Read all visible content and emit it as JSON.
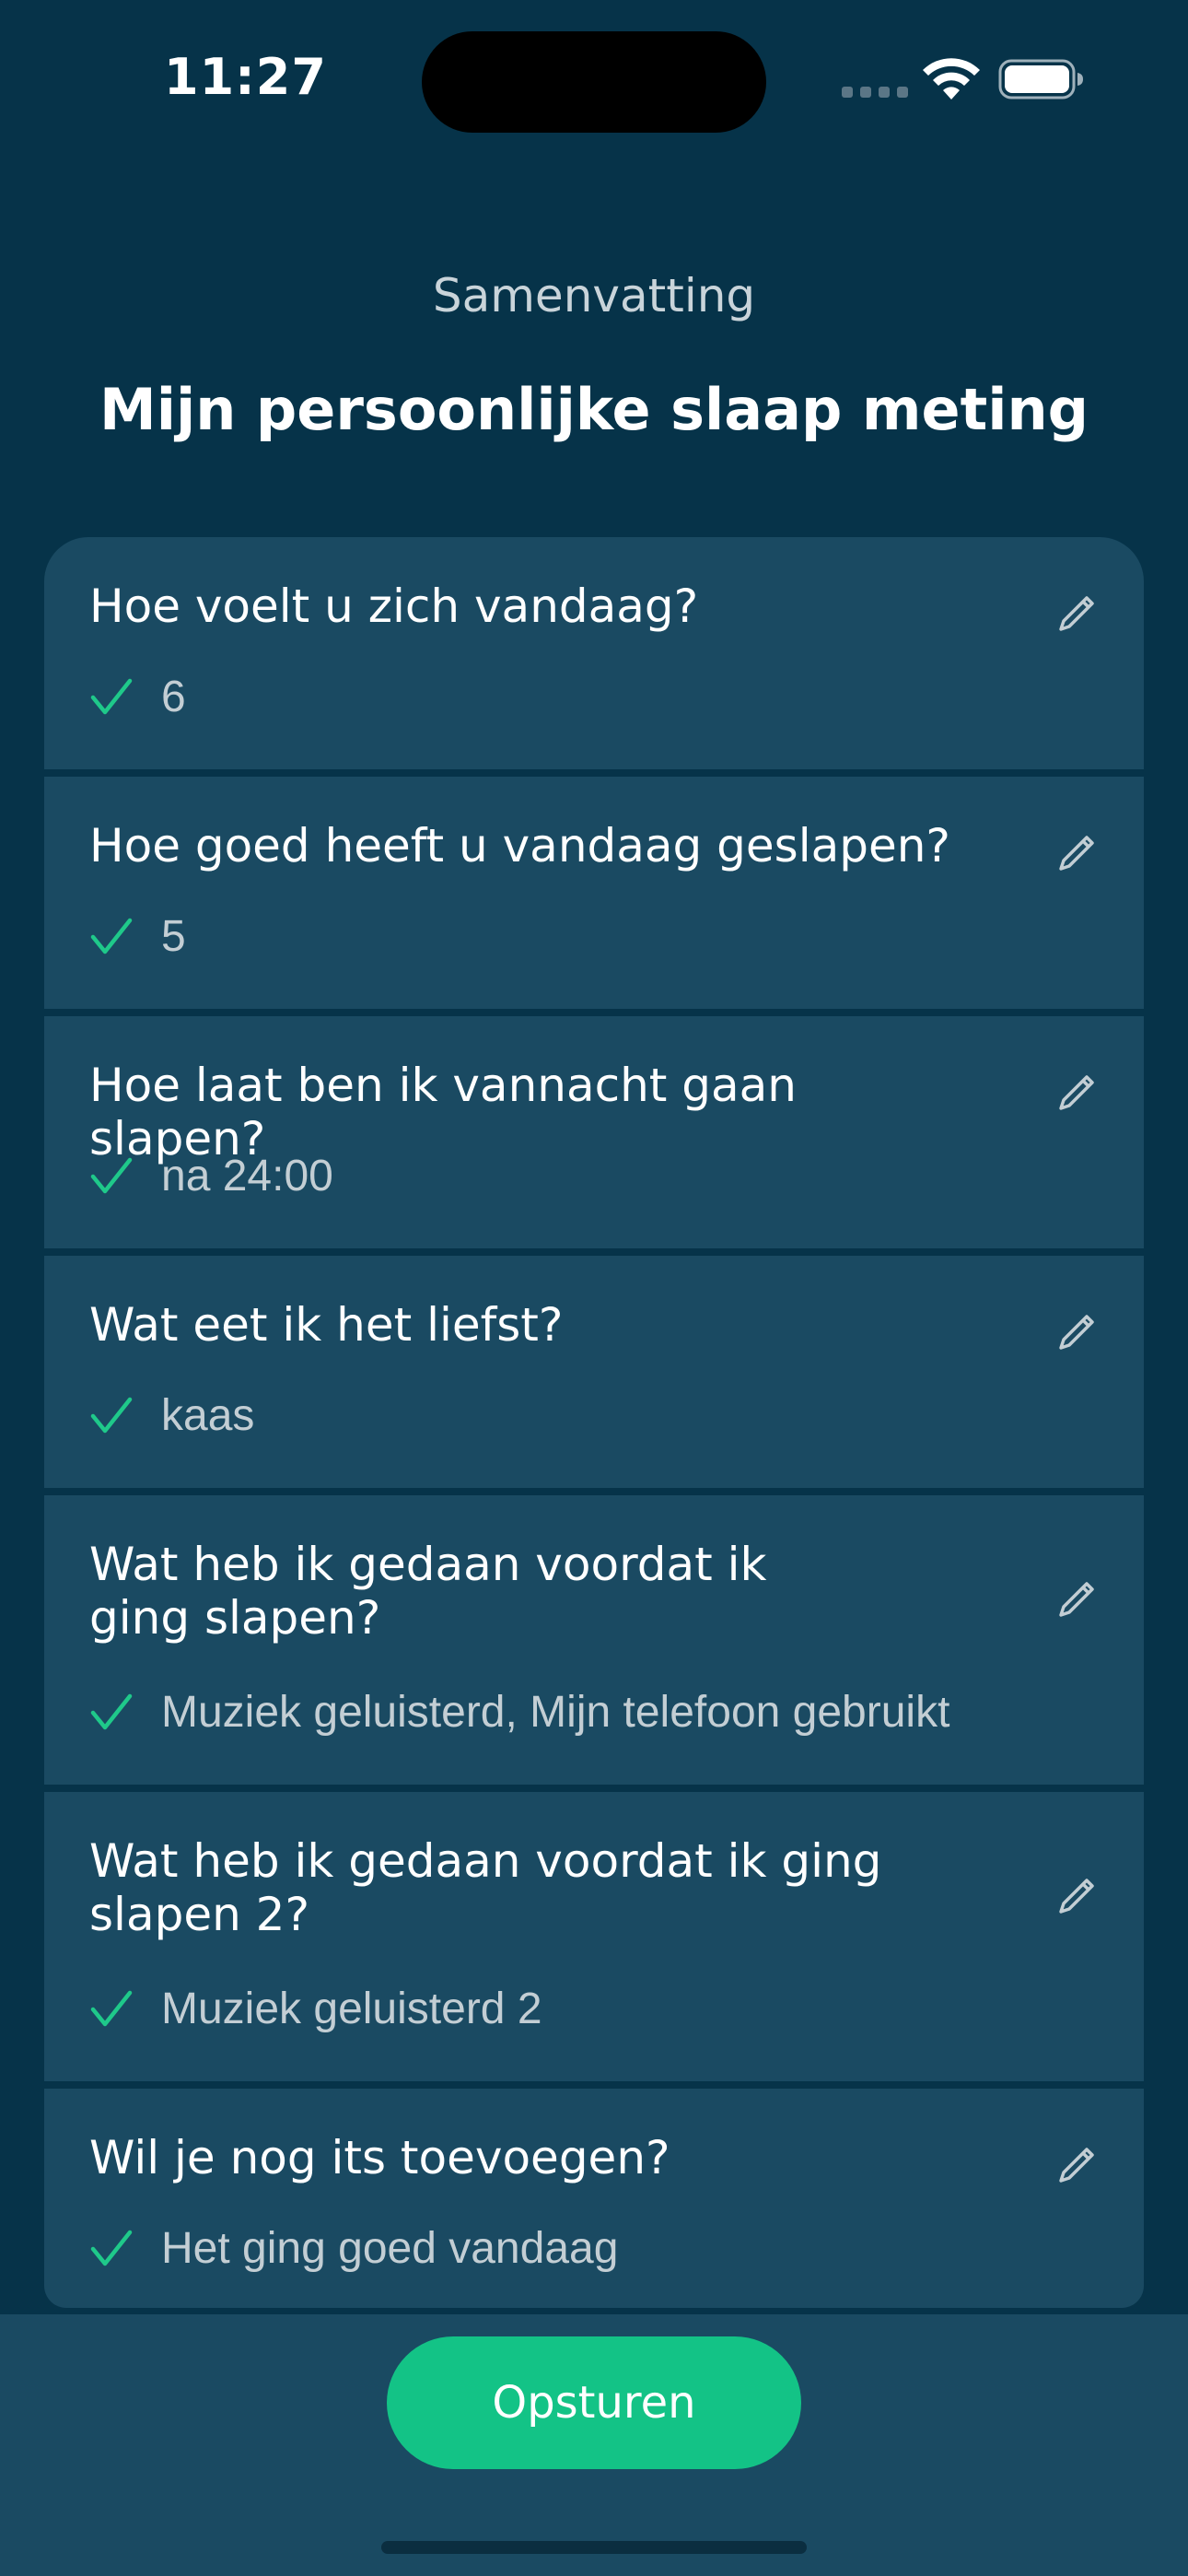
{
  "status_bar": {
    "time": "11:27"
  },
  "header": {
    "subtitle": "Samenvatting",
    "title": "Mijn persoonlijke slaap meting"
  },
  "questions": [
    {
      "question": "Hoe voelt u zich vandaag?",
      "answer": "6"
    },
    {
      "question": "Hoe goed heeft u vandaag geslapen?",
      "answer": "5"
    },
    {
      "question": "Hoe laat ben ik vannacht gaan slapen?",
      "answer": "na 24:00"
    },
    {
      "question": "Wat eet ik het liefst?",
      "answer": "kaas"
    },
    {
      "question": "Wat heb ik gedaan voordat ik\nging slapen?",
      "answer": "Muziek geluisterd, Mijn telefoon gebruikt"
    },
    {
      "question": "Wat heb ik gedaan voordat ik ging\nslapen 2?",
      "answer": "Muziek geluisterd 2"
    },
    {
      "question": "Wil je nog its toevoegen?",
      "answer": "Het ging goed vandaag"
    }
  ],
  "actions": {
    "submit_label": "Opsturen"
  },
  "icons": {
    "check": "check-icon",
    "edit": "pencil-icon",
    "wifi": "wifi-icon",
    "battery": "battery-icon"
  },
  "colors": {
    "background": "#063349",
    "card": "#1a4a62",
    "accent": "#13c386",
    "check": "#1fc98a"
  }
}
